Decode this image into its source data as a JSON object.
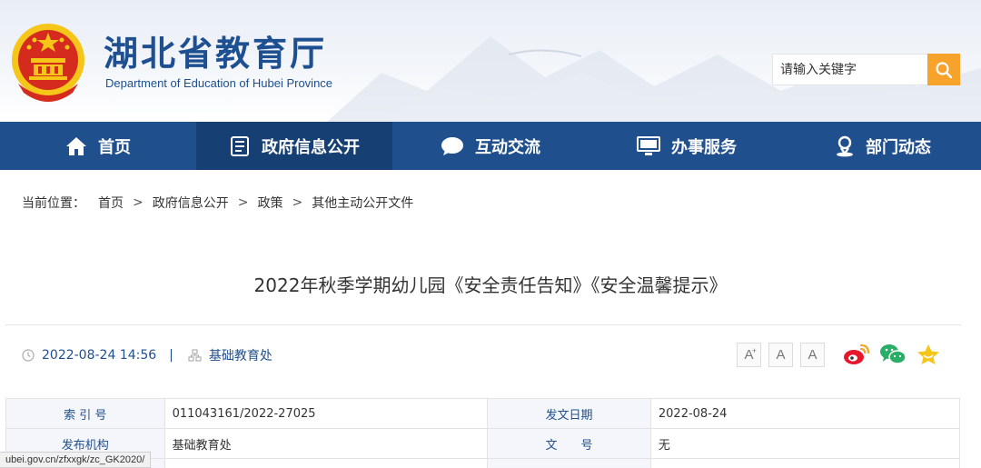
{
  "header": {
    "title": "湖北省教育厅",
    "subtitle": "Department of Education of Hubei Province",
    "search_placeholder": "请输入关键字"
  },
  "nav": {
    "items": [
      {
        "label": "首页",
        "icon": "home-icon"
      },
      {
        "label": "政府信息公开",
        "icon": "document-list-icon",
        "active": true
      },
      {
        "label": "互动交流",
        "icon": "chat-bubble-icon"
      },
      {
        "label": "办事服务",
        "icon": "monitor-icon"
      },
      {
        "label": "部门动态",
        "icon": "location-person-icon"
      }
    ]
  },
  "breadcrumb": {
    "label": "当前位置：",
    "items": [
      "首页",
      "政府信息公开",
      "政策",
      "其他主动公开文件"
    ],
    "separator": ">"
  },
  "article": {
    "title": "2022年秋季学期幼儿园《安全责任告知》《安全温馨提示》",
    "datetime": "2022-08-24 14:56",
    "pipe": "|",
    "department": "基础教育处"
  },
  "font_controls": [
    "A",
    "A",
    "A"
  ],
  "font_control_plus": "+",
  "share": [
    "weibo-icon",
    "wechat-icon",
    "favorite-star-icon"
  ],
  "info_table": {
    "rows": [
      [
        "索 引 号",
        "011043161/2022-27025",
        "发文日期",
        "2022-08-24"
      ],
      [
        "发布机构",
        "基础教育处",
        "文　　号",
        "无"
      ]
    ]
  },
  "status_url": "ubei.gov.cn/zfxxgk/zc_GK2020/",
  "colors": {
    "brand_blue": "#1f4f8d",
    "nav_active": "#163f74",
    "search_orange": "#f7a22a",
    "emblem_red": "#d52b1e",
    "emblem_gold": "#f5c518"
  }
}
